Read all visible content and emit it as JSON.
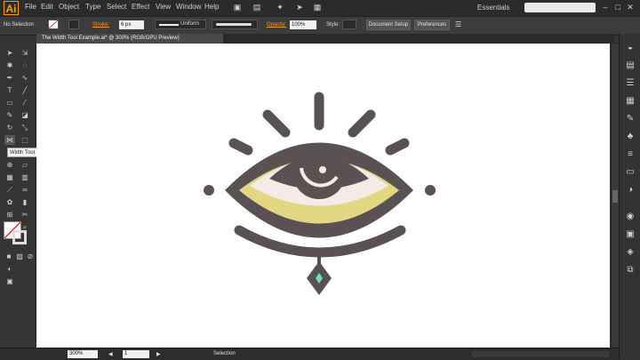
{
  "app": {
    "logo": "Ai",
    "workspace": "Essentials"
  },
  "menu": [
    "File",
    "Edit",
    "Object",
    "Type",
    "Select",
    "Effect",
    "View",
    "Window",
    "Help"
  ],
  "control_bar": {
    "selection_label": "No Selection",
    "stroke_label": "Stroke:",
    "stroke_value": "6 px",
    "profile": "Uniform",
    "opacity_label": "Opacity:",
    "opacity_value": "100%",
    "style_label": "Style:",
    "document_setup": "Document Setup",
    "preferences": "Preferences"
  },
  "document_tab": {
    "title": "The Width Tool Example.ai* @ 300% (RGB/GPU Preview)"
  },
  "tooltip": "Width Tool (Shift+W)",
  "status_bar": {
    "zoom": "300%",
    "artboard": "1",
    "tool": "Selection"
  },
  "icons": [
    "selection-icon",
    "direct-selection-icon",
    "magic-wand-icon",
    "lasso-icon",
    "pen-icon",
    "curvature-icon",
    "type-icon",
    "line-icon",
    "rectangle-icon",
    "paintbrush-icon",
    "shaper-icon",
    "eraser-icon",
    "rotate-icon",
    "scale-icon",
    "width-icon",
    "free-transform-icon",
    "shape-builder-icon",
    "perspective-icon",
    "mesh-icon",
    "gradient-icon",
    "eyedropper-icon",
    "blend-icon",
    "symbol-sprayer-icon",
    "graph-icon",
    "artboard-icon",
    "slice-icon",
    "hand-icon",
    "zoom-icon"
  ],
  "colors": {
    "eye_outline": "#5a5153",
    "eye_yellow": "#e3d783",
    "eye_white": "#f3ece6",
    "iris": "#5a5153",
    "gem": "#6ee0c0",
    "accent": "#f29a2e"
  }
}
